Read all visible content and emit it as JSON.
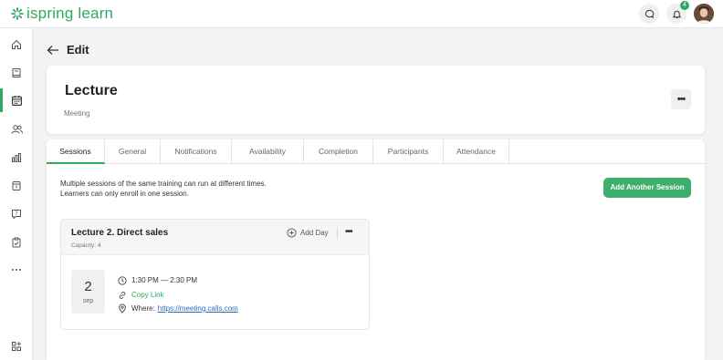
{
  "app": {
    "logo_text": "ispring learn",
    "notification_count": "4"
  },
  "sidebar": {
    "items": [
      {
        "icon": "home-icon"
      },
      {
        "icon": "book-icon"
      },
      {
        "icon": "calendar-icon",
        "active": true
      },
      {
        "icon": "users-icon"
      },
      {
        "icon": "chart-icon"
      },
      {
        "icon": "document-icon"
      },
      {
        "icon": "question-icon"
      },
      {
        "icon": "clipboard-check-icon"
      },
      {
        "icon": "more-icon"
      },
      {
        "icon": "add-apps-icon"
      }
    ]
  },
  "page": {
    "title": "Edit"
  },
  "header": {
    "title": "Lecture",
    "type": "Meeting",
    "more_label": "•••"
  },
  "tabs": [
    {
      "label": "Sessions"
    },
    {
      "label": "General"
    },
    {
      "label": "Notifications"
    },
    {
      "label": "Availability"
    },
    {
      "label": "Completion"
    },
    {
      "label": "Participants"
    },
    {
      "label": "Attendance"
    }
  ],
  "sessions": {
    "description_line1": "Multiple sessions of the same training can run at different times.",
    "description_line2": "Learners can only enroll in one session.",
    "add_button": "Add Another Session",
    "card": {
      "title": "Lecture 2. Direct sales",
      "capacity": "Capacity: 4",
      "add_day": "Add Day",
      "more_label": "•••",
      "date_day": "2",
      "date_month": "sep",
      "time": "1:30 PM — 2:30 PM",
      "copy_link": "Copy Link",
      "where_label": "Where:",
      "where_url": "https://meeting.calls.com"
    }
  },
  "colors": {
    "accent": "#2fa866",
    "button": "#3dae6b",
    "link": "#2b6cc4"
  }
}
